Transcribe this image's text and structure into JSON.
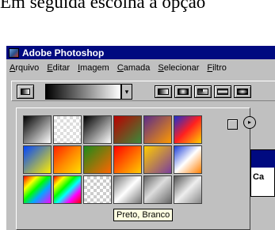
{
  "caption": "Em seguida escolha a opção",
  "window": {
    "title": "Adobe Photoshop"
  },
  "menu": {
    "items": [
      {
        "underline": "A",
        "rest": "rquivo"
      },
      {
        "underline": "E",
        "rest": "ditar"
      },
      {
        "underline": "I",
        "rest": "magem"
      },
      {
        "underline": "C",
        "rest": "amada"
      },
      {
        "underline": "S",
        "rest": "elecionar"
      },
      {
        "underline": "F",
        "rest": "iltro"
      }
    ]
  },
  "toolbar": {
    "gradient_dropdown_symbol": "▾"
  },
  "gradient_panel": {
    "menu_symbol": "▸",
    "tooltip": "Preto, Branco",
    "swatches": [
      {
        "css": "linear-gradient(135deg,#000 0%,#fff 100%)"
      },
      {
        "css": "repeating-conic-gradient(#ddd 0% 25%,#fff 0% 50%) 0 0/8px 8px"
      },
      {
        "css": "linear-gradient(135deg,#000 0%,#fff 100%)"
      },
      {
        "css": "linear-gradient(135deg,#b00 0%,#3a8a3a 100%)"
      },
      {
        "css": "linear-gradient(135deg,#5b2c8a 0%,#ff9900 100%)"
      },
      {
        "css": "linear-gradient(135deg,#1a2fd0 0%,#ff2020 50%,#ffd000 100%)"
      },
      {
        "css": "linear-gradient(135deg,#0044ff 0%,#ffee00 100%)"
      },
      {
        "css": "linear-gradient(135deg,#ff2000 0%,#ff8800 50%,#ffe000 100%)"
      },
      {
        "css": "linear-gradient(135deg,#1a8a1a 0%,#ff6600 100%)"
      },
      {
        "css": "linear-gradient(135deg,#ff0000 0%,#ffcc00 100%)"
      },
      {
        "css": "linear-gradient(135deg,#ffcc00 0%,#7a3e9d 100%)"
      },
      {
        "css": "linear-gradient(135deg,#1c3fd8 0%,#ffffff 50%,#ff7f00 100%)"
      },
      {
        "css": "linear-gradient(135deg,#ff0000 0%,#ffff00 25%,#00ff00 45%,#00aaff 65%,#ff00ff 100%)"
      },
      {
        "css": "linear-gradient(135deg,#ff0000 0%,#ffff00 20%,#00ff00 40%,#00ffff 55%,#ff00ff 75%,#ff0000 100%)"
      },
      {
        "css": "repeating-conic-gradient(#ccc 0% 25%,#fff 0% 50%) 0 0/8px 8px"
      },
      {
        "css": "linear-gradient(135deg,#777 0%,#fff 50%,#777 100%)"
      },
      {
        "css": "linear-gradient(135deg,#666 0%,#ddd 45%,#666 100%)"
      },
      {
        "css": "linear-gradient(135deg,#555 0%,#eee 50%,#888 100%)"
      }
    ]
  },
  "side_panel": {
    "label": "Ca"
  }
}
